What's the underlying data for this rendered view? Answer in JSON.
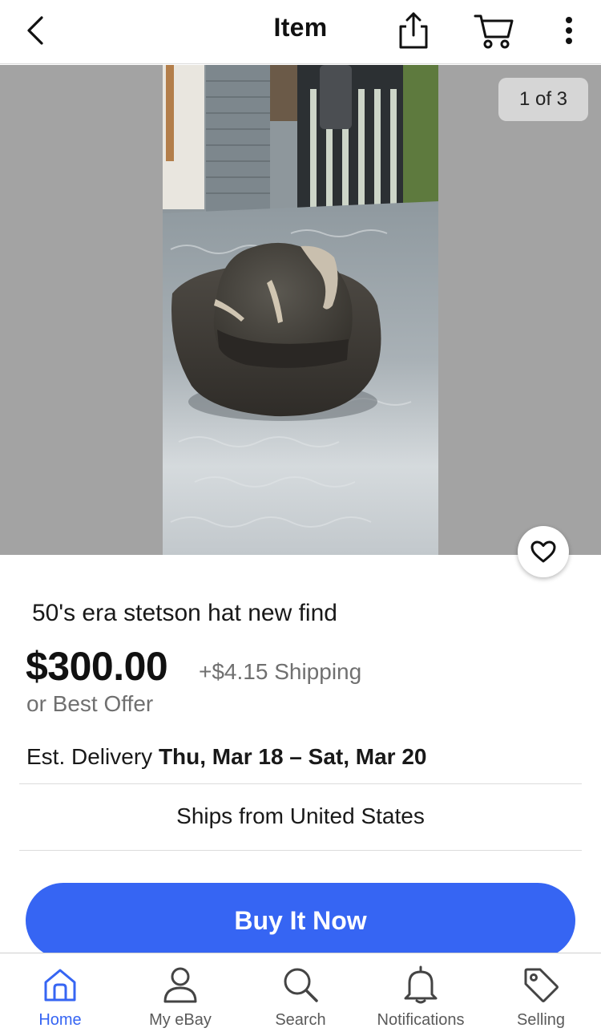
{
  "header": {
    "title": "Item",
    "icons": [
      "back-chevron-icon",
      "share-icon",
      "cart-icon",
      "more-vertical-icon"
    ]
  },
  "gallery": {
    "counter": "1 of 3",
    "watch_icon": "heart-icon"
  },
  "listing": {
    "title": "50's era stetson hat new find",
    "price": "$300.00",
    "shipping": "+$4.15 Shipping",
    "best_offer": "or Best Offer",
    "delivery_label": "Est. Delivery",
    "delivery_range": "Thu, Mar 18 – Sat, Mar 20",
    "ships_from": "Ships from United States"
  },
  "actions": {
    "buy_now": "Buy It Now"
  },
  "tabbar": {
    "items": [
      {
        "label": "Home",
        "icon": "home-icon",
        "active": true
      },
      {
        "label": "My eBay",
        "icon": "person-icon",
        "active": false
      },
      {
        "label": "Search",
        "icon": "search-icon",
        "active": false
      },
      {
        "label": "Notifications",
        "icon": "bell-icon",
        "active": false
      },
      {
        "label": "Selling",
        "icon": "tag-icon",
        "active": false
      }
    ]
  },
  "colors": {
    "accent": "#3665f3",
    "gallery_bg": "#a3a3a3",
    "secondary_text": "#707070"
  }
}
